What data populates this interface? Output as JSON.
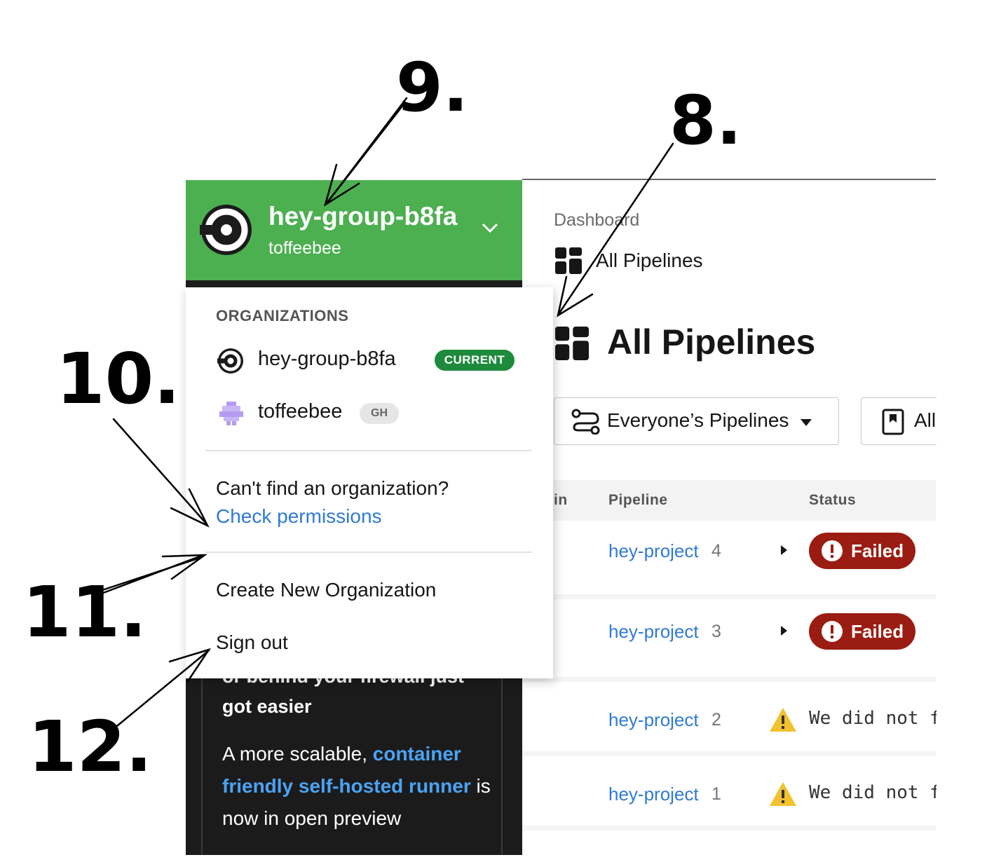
{
  "sidebar": {
    "org_name": "hey-group-b8fa",
    "org_user": "toffeebee",
    "accent_color": "#4caf50",
    "promo": {
      "cut_line": "or behind your firewall just",
      "title": "got easier",
      "body_prefix": "A more scalable, ",
      "body_link": "container friendly self-hosted runner",
      "body_suffix": " is now in open preview"
    }
  },
  "dropdown": {
    "heading": "ORGANIZATIONS",
    "organizations": [
      {
        "name": "hey-group-b8fa",
        "badge": "CURRENT",
        "icon": "circleci-logo-icon"
      },
      {
        "name": "toffeebee",
        "badge": "GH",
        "icon": "github-avatar-icon"
      }
    ],
    "cant_find": "Can't find an organization?",
    "check_permissions": "Check permissions",
    "create_org": "Create New Organization",
    "sign_out": "Sign out"
  },
  "main": {
    "breadcrumb": "Dashboard",
    "breadcrumb_title": "All Pipelines",
    "title": "All Pipelines",
    "filter_label": "Everyone’s Pipelines",
    "branch_label": "All",
    "table": {
      "columns": [
        "in",
        "Pipeline",
        "Status"
      ],
      "rows": [
        {
          "project": "hey-project",
          "number": "4",
          "status": "Failed"
        },
        {
          "project": "hey-project",
          "number": "3",
          "status": "Failed"
        },
        {
          "project": "hey-project",
          "number": "2",
          "status": "We did not f"
        },
        {
          "project": "hey-project",
          "number": "1",
          "status": "We did not f"
        }
      ]
    }
  },
  "annotations": [
    "9.",
    "8.",
    "10.",
    "11.",
    "12."
  ]
}
